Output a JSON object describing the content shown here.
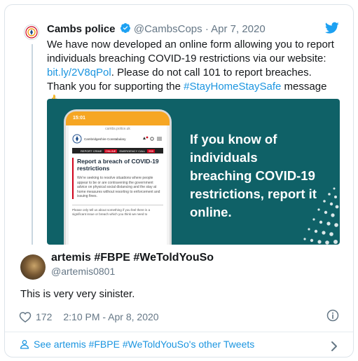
{
  "quoted_tweet": {
    "author_name": "Cambs police",
    "handle": "@CambsCops",
    "date": "Apr 7, 2020",
    "text_before_link": "We have now developed an online form allowing you to report individuals breaching COVID-19 restrictions via our website: ",
    "link": "bit.ly/2V8qPol",
    "text_after_link": ". Please do not call 101 to report breaches. Thank you for supporting the ",
    "hashtag": "#StayHomeStaySafe",
    "text_end": " message 👍",
    "media": {
      "phone_time": "15:01",
      "phone_url": "cambs.police.uk",
      "phone_logo_text": "Cambridgeshire Constabulary",
      "phone_bar_left": "REPORT CRIME",
      "phone_bar_badge": "ONLINE",
      "phone_bar_right": "EMERGENCY CALL",
      "phone_bar_number": "999",
      "phone_heading": "Report a breach of COVID-19 restrictions",
      "phone_paragraph": "We're seeking to resolve situations where people appear to be or are contravening the government advice on physical social distancing and the stay at home measures without resorting to enforcement and issuing fines.",
      "phone_paragraph2": "Please only tell us about something if you feel there is a significant issue or breach which you think we need to",
      "headline": "If you know of individuals breaching COVID-19 restrictions, report it online."
    }
  },
  "tweet": {
    "author_name": "artemis #FBPE #WeToldYouSo",
    "handle": "@artemis0801",
    "text": "This is very very sinister.",
    "likes": "172",
    "timestamp": "2:10 PM - Apr 8, 2020"
  },
  "footer": {
    "link_text": "See artemis #FBPE #WeToldYouSo's other Tweets"
  },
  "colors": {
    "link": "#1b95e0",
    "media_bg": "#0f6167",
    "verified": "#1da1f2"
  }
}
